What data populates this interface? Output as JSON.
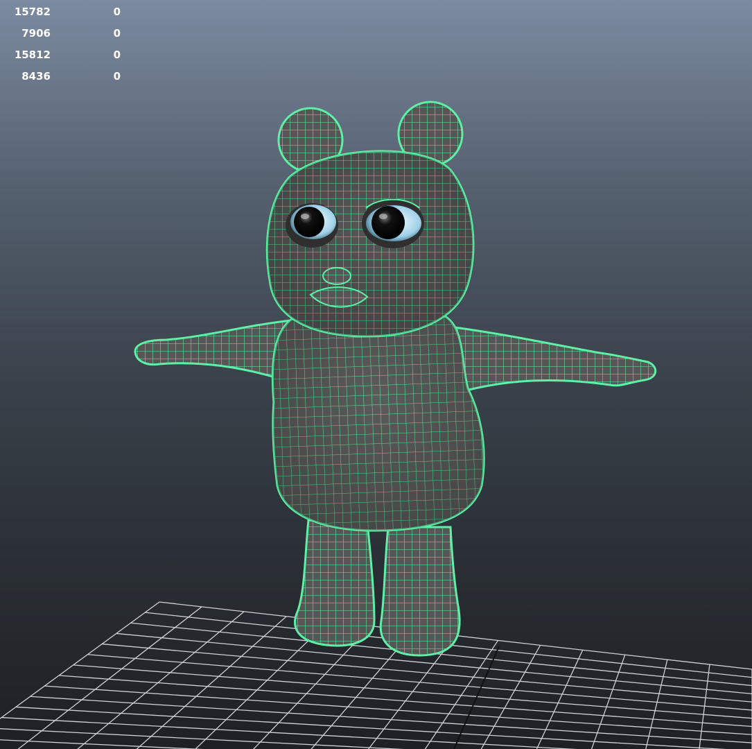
{
  "viewport": {
    "background_top": "#7c8ba1",
    "background_bottom": "#1d2024"
  },
  "hud": {
    "rows": [
      {
        "count": "15782",
        "selected": "0"
      },
      {
        "count": "7906",
        "selected": "0"
      },
      {
        "count": "15812",
        "selected": "0"
      },
      {
        "count": "8436",
        "selected": "0"
      }
    ]
  },
  "model": {
    "wire_color": "#5ef0a6",
    "shade_color": "#565656",
    "icons": [
      "wireframe-on-shaded-bear-model",
      "ground-grid"
    ]
  }
}
